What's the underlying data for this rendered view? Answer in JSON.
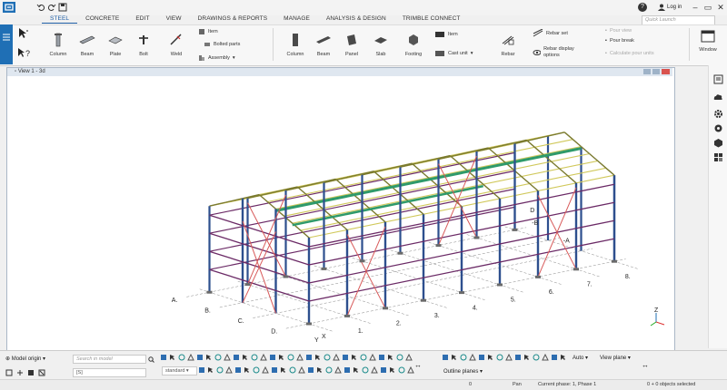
{
  "app": {
    "help": "?",
    "login_label": "Log in",
    "quick_launch_placeholder": "Quick Launch"
  },
  "tabs": [
    "STEEL",
    "CONCRETE",
    "EDIT",
    "VIEW",
    "DRAWINGS & REPORTS",
    "MANAGE",
    "ANALYSIS & DESIGN",
    "TRIMBLE CONNECT"
  ],
  "ribbon": {
    "steel": {
      "column": "Column",
      "beam": "Beam",
      "plate": "Plate",
      "bolt": "Bolt",
      "weld": "Weld",
      "item": "Item",
      "bolted_parts": "Bolted parts",
      "assembly": "Assembly"
    },
    "concrete": {
      "column": "Column",
      "beam": "Beam",
      "panel": "Panel",
      "slab": "Slab",
      "footing": "Footing",
      "item": "Item",
      "cast_unit": "Cast unit",
      "rebar": "Rebar",
      "rebar_set": "Rebar set",
      "rebar_display_options": "Rebar display options",
      "pour_view": "Pour view",
      "pour_break": "Pour break",
      "calculate_pour_units": "Calculate pour units"
    },
    "window": "Window"
  },
  "view": {
    "title": "View 1 - 3d"
  },
  "grid_labels": {
    "rows": [
      "A.",
      "B.",
      "C.",
      "D."
    ],
    "row_ticks": [
      "1.",
      "2.",
      "3.",
      "4.",
      "5.",
      "6.",
      "7.",
      "8."
    ],
    "far_labels": [
      "D",
      "-B",
      "-A"
    ],
    "coord": [
      "Z",
      "Y",
      "X"
    ]
  },
  "bottom": {
    "model_origin": "Model origin",
    "search_placeholder": "Search in model",
    "search_value": "[S]",
    "standard": "standard",
    "auto": "Auto",
    "view_plane": "View plane",
    "outline_planes": "Outline planes"
  },
  "status": {
    "coord_zero": "0",
    "mode": "Pan",
    "phase": "Current phase: 1, Phase 1",
    "selection": "0 + 0 objects selected"
  },
  "colors": {
    "accent": "#1f6fb5",
    "column": "#2d4f8e",
    "beam": "#7a7a2f",
    "purlin": "#d0c85a",
    "brace": "#d85a5a",
    "girt": "#6b2a66",
    "green": "#2f9a6b"
  }
}
